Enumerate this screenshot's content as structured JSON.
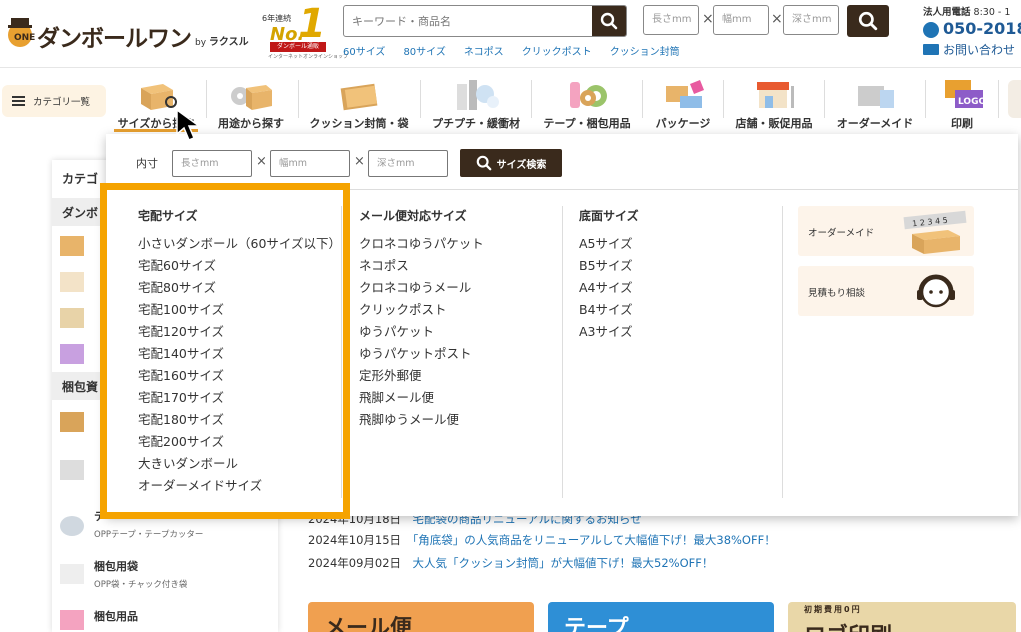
{
  "header": {
    "logo_text": "ダンボールワン",
    "logo_by": "by",
    "logo_brand": "ラクスル",
    "award_top": "6年連続",
    "award_main": "No.",
    "award_number": "1",
    "award_ribbon": "ダンボール通販",
    "award_sub": "インターネットオンラインショップ",
    "search_placeholder": "キーワード・商品名",
    "size_placeholders": {
      "length": "長さmm",
      "width": "幅mm",
      "depth": "深さmm"
    },
    "times": "×",
    "quick_links": [
      "60サイズ",
      "80サイズ",
      "ネコポス",
      "クリックポスト",
      "クッション封筒"
    ],
    "corp_label": "法人用電話",
    "corp_hours": " 8:30 - 1",
    "phone": "050-2018-",
    "contact": "お問い合わせ"
  },
  "nav": {
    "category_list": "カテゴリ一覧",
    "items": [
      {
        "label": "サイズから探す",
        "icon": "box-magnifier-icon"
      },
      {
        "label": "用途から探す",
        "icon": "box-cd-icon"
      },
      {
        "label": "クッション封筒・袋",
        "icon": "envelope-icon"
      },
      {
        "label": "プチプチ・緩衝材",
        "icon": "bubble-wrap-icon"
      },
      {
        "label": "テープ・梱包用品",
        "icon": "tape-icon"
      },
      {
        "label": "パッケージ",
        "icon": "package-icon"
      },
      {
        "label": "店舗・販促用品",
        "icon": "shop-icon"
      },
      {
        "label": "オーダーメイド",
        "icon": "custom-box-icon"
      },
      {
        "label": "印刷",
        "icon": "logo-print-icon"
      }
    ]
  },
  "dropdown": {
    "size_label": "内寸",
    "placeholders": {
      "length": "長さmm",
      "width": "幅mm",
      "depth": "深さmm"
    },
    "search_button": "サイズ検索",
    "columns": [
      {
        "heading": "宅配サイズ",
        "items": [
          "小さいダンボール（60サイズ以下）",
          "宅配60サイズ",
          "宅配80サイズ",
          "宅配100サイズ",
          "宅配120サイズ",
          "宅配140サイズ",
          "宅配160サイズ",
          "宅配170サイズ",
          "宅配180サイズ",
          "宅配200サイズ",
          "大きいダンボール",
          "オーダーメイドサイズ"
        ]
      },
      {
        "heading": "メール便対応サイズ",
        "items": [
          "クロネコゆうパケット",
          "ネコポス",
          "クロネコゆうメール",
          "クリックポスト",
          "ゆうパケット",
          "ゆうパケットポスト",
          "定形外郵便",
          "飛脚メール便",
          "飛脚ゆうメール便"
        ]
      },
      {
        "heading": "底面サイズ",
        "items": [
          "A5サイズ",
          "B5サイズ",
          "A4サイズ",
          "B4サイズ",
          "A3サイズ"
        ]
      }
    ],
    "cards": [
      {
        "label": "オーダーメイド",
        "icon": "custom-box-ruler-icon"
      },
      {
        "label": "見積もり相談",
        "icon": "headset-support-icon"
      }
    ]
  },
  "sidebar": {
    "heading": "カテゴ",
    "section1": "ダンボ",
    "section2": "梱包資",
    "items": [
      {
        "title": "テ",
        "sub": "OPPテープ・テープカッター",
        "icon": "tape-roll-icon"
      },
      {
        "title": "梱包用袋",
        "sub": "OPP袋・チャック付き袋",
        "icon": "bag-icon"
      },
      {
        "title": "梱包用品",
        "sub": "",
        "icon": "packing-supplies-icon"
      }
    ]
  },
  "news": [
    {
      "date": "2024年10月18日",
      "text": "宅配袋の商品リニューアルに関するお知らせ"
    },
    {
      "date": "2024年10月15日",
      "text": "「角底袋」の人気商品をリニューアルして大幅値下げ！最大38%OFF！"
    },
    {
      "date": "2024年09月02日",
      "text": "大人気「クッション封筒」が大幅値下げ！最大52%OFF！"
    }
  ],
  "promos": [
    {
      "text": "メール便",
      "color": "#f0a050"
    },
    {
      "text": "テープ",
      "color": "#2e8fd6"
    },
    {
      "text": "ロゴ印刷",
      "badge": "初期費用0円",
      "color": "#e9d7a8"
    }
  ],
  "colors": {
    "brand_dark": "#3a2a1c",
    "accent": "#e8a030",
    "highlight_border": "#f5a300",
    "link": "#1f74b5"
  }
}
